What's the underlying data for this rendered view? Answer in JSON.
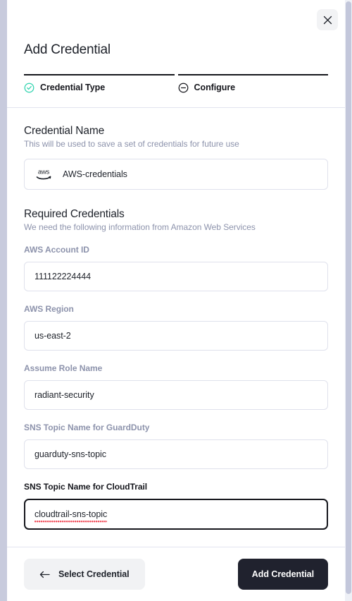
{
  "dialog": {
    "title": "Add Credential",
    "close_label": "×",
    "close_icon": "close-icon"
  },
  "tabs": [
    {
      "label": "Credential Type",
      "icon": "check-circle-icon",
      "state": "complete",
      "accent": "#2ed3ae"
    },
    {
      "label": "Configure",
      "icon": "minus-circle-icon",
      "state": "current",
      "accent": "#15161c"
    }
  ],
  "credential_name": {
    "title": "Credential Name",
    "subtitle": "This will be used to save a set of credentials for future use",
    "provider_icon": "aws-logo-icon",
    "value": "AWS-credentials"
  },
  "required_credentials": {
    "title": "Required Credentials",
    "subtitle": "We need the following information from Amazon Web Services",
    "fields": [
      {
        "label": "AWS Account ID",
        "value": "111122224444",
        "focused": false,
        "spellcheck_error": false
      },
      {
        "label": "AWS Region",
        "value": "us-east-2",
        "focused": false,
        "spellcheck_error": false
      },
      {
        "label": "Assume Role Name",
        "value": "radiant-security",
        "focused": false,
        "spellcheck_error": false
      },
      {
        "label": "SNS Topic Name for GuardDuty",
        "value": "guarduty-sns-topic",
        "focused": false,
        "spellcheck_error": false
      },
      {
        "label": "SNS Topic Name for CloudTrail",
        "value": "cloudtrail-sns-topic",
        "focused": true,
        "spellcheck_error": true
      }
    ]
  },
  "footer": {
    "back_label": "Select Credential",
    "back_icon": "arrow-left-icon",
    "submit_label": "Add Credential"
  },
  "colors": {
    "accent_success": "#2ed3ae",
    "text_primary": "#1d2129",
    "text_muted": "#8d93ac",
    "border": "#dfe1ec",
    "primary_button": "#20222e",
    "spellcheck_error": "#ef4a57"
  }
}
